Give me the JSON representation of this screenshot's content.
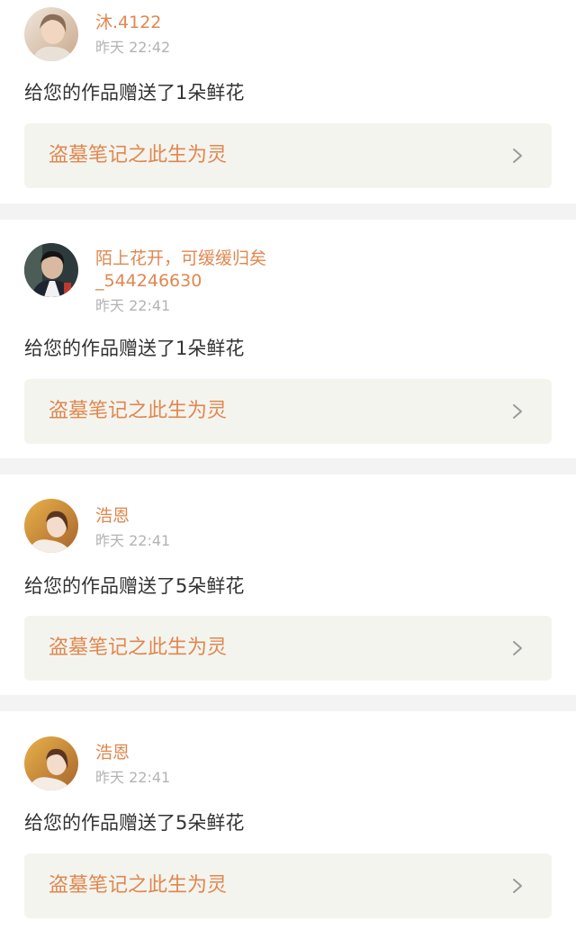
{
  "notifications": [
    {
      "username": "沐.4122",
      "time": "昨天 22:42",
      "message": "给您的作品赠送了1朵鲜花",
      "work_title": "盗墓笔记之此生为灵"
    },
    {
      "username": "陌上花开，可缓缓归矣",
      "username_line2": "_544246630",
      "time": "昨天 22:41",
      "message": "给您的作品赠送了1朵鲜花",
      "work_title": "盗墓笔记之此生为灵"
    },
    {
      "username": "浩恩",
      "time": "昨天 22:41",
      "message": "给您的作品赠送了5朵鲜花",
      "work_title": "盗墓笔记之此生为灵"
    },
    {
      "username": "浩恩",
      "time": "昨天 22:41",
      "message": "给您的作品赠送了5朵鲜花",
      "work_title": "盗墓笔记之此生为灵"
    }
  ],
  "colors": {
    "accent": "#e0874f",
    "timestamp": "#b3b3b3",
    "message": "#333333",
    "link_bg": "#f4f4ef",
    "divider": "#f3f3f3"
  },
  "icons": {
    "avatar": "avatar",
    "chevron": "chevron-right-icon"
  }
}
